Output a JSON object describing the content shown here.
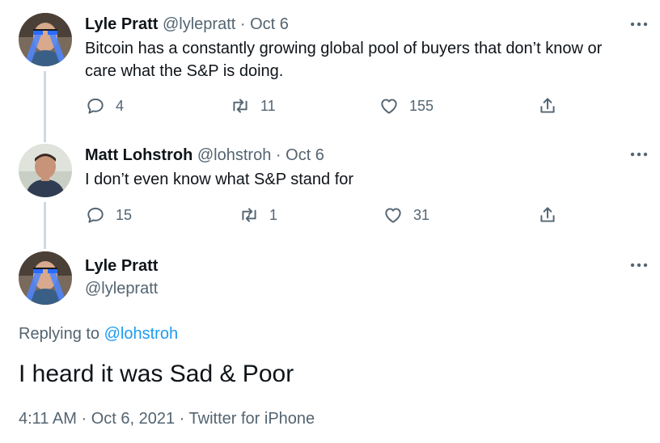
{
  "tweets": [
    {
      "name": "Lyle Pratt",
      "handle": "@lylepratt",
      "separator": "·",
      "date": "Oct 6",
      "text_line1": "Bitcoin has a constantly growing global pool of buyers that don’t know or",
      "text_line2": "care what the S&P is doing.",
      "replies": "4",
      "retweets": "11",
      "likes": "155"
    },
    {
      "name": "Matt Lohstroh",
      "handle": "@lohstroh",
      "separator": "·",
      "date": "Oct 6",
      "text_line1": "I don’t even know what S&P stand for",
      "replies": "15",
      "retweets": "1",
      "likes": "31"
    }
  ],
  "main_tweet": {
    "name": "Lyle Pratt",
    "handle": "@lylepratt",
    "replying_prefix": "Replying to",
    "replying_handle": "@lohstroh",
    "text": "I heard it was Sad & Poor",
    "time": "4:11 AM",
    "dot1": "·",
    "date": "Oct 6, 2021",
    "dot2": "·",
    "source": "Twitter for iPhone"
  },
  "colors": {
    "text": "#0f1419",
    "muted": "#536471",
    "link": "#1d9bf0",
    "thread_line": "#cfd9de"
  },
  "icons": {
    "more": "more-icon",
    "reply": "reply-icon",
    "retweet": "retweet-icon",
    "like": "heart-icon",
    "share": "share-icon"
  }
}
